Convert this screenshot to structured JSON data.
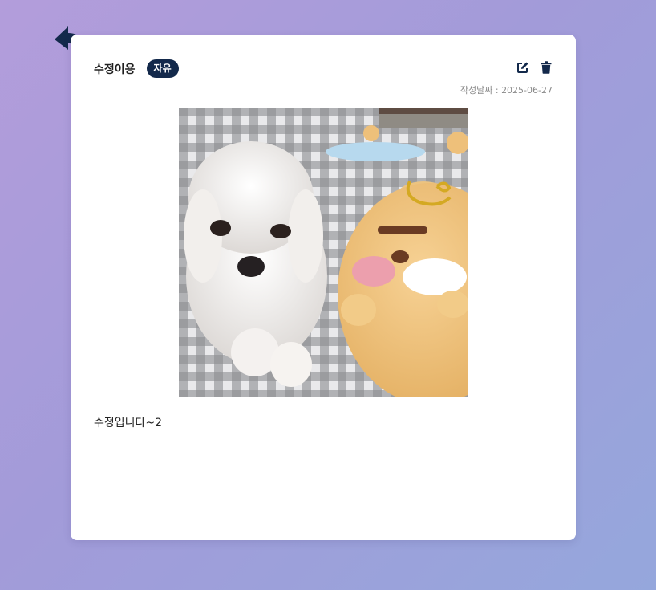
{
  "post": {
    "title": "수정이용",
    "category": "자유",
    "date_label": "작성날짜",
    "date_separator": " : ",
    "date": "2025-06-27",
    "content": "수정입니다~2"
  },
  "icons": {
    "back": "reply-arrow-icon",
    "edit": "edit-icon",
    "delete": "trash-icon"
  },
  "colors": {
    "accent": "#13294b",
    "background_start": "#b39ddb",
    "background_end": "#95a7dc"
  }
}
